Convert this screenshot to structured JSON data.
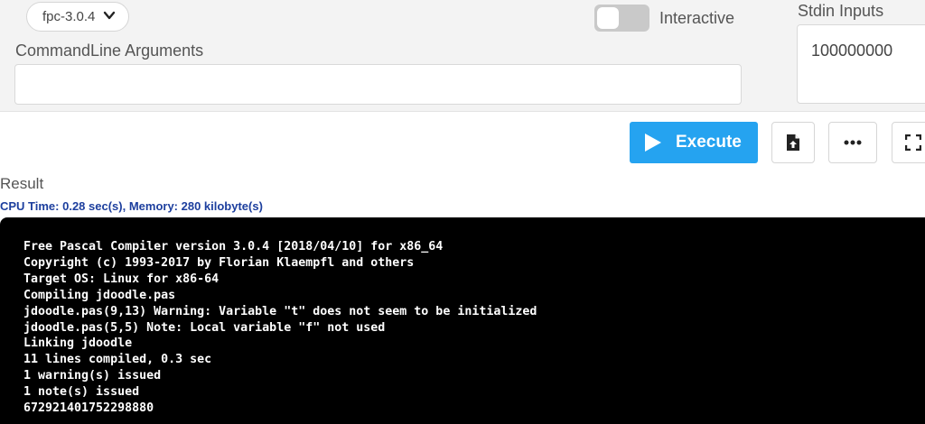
{
  "toolbar": {
    "version": "fpc-3.0.4",
    "interactive_label": "Interactive",
    "interactive_on": false,
    "cmdline_label": "CommandLine Arguments",
    "cmdline_value": "",
    "stdin_label": "Stdin Inputs",
    "stdin_value": "100000000"
  },
  "actions": {
    "execute_label": "Execute",
    "accent_color": "#25a3f0",
    "upload_icon": "file-upload-icon",
    "more_icon": "more-dots-icon",
    "fullscreen_icon": "fullscreen-icon"
  },
  "result": {
    "label": "Result",
    "stats": "CPU Time: 0.28 sec(s), Memory: 280 kilobyte(s)",
    "output": [
      "Free Pascal Compiler version 3.0.4 [2018/04/10] for x86_64",
      "Copyright (c) 1993-2017 by Florian Klaempfl and others",
      "Target OS: Linux for x86-64",
      "Compiling jdoodle.pas",
      "jdoodle.pas(9,13) Warning: Variable \"t\" does not seem to be initialized",
      "jdoodle.pas(5,5) Note: Local variable \"f\" not used",
      "Linking jdoodle",
      "11 lines compiled, 0.3 sec",
      "1 warning(s) issued",
      "1 note(s) issued",
      "672921401752298880"
    ]
  }
}
